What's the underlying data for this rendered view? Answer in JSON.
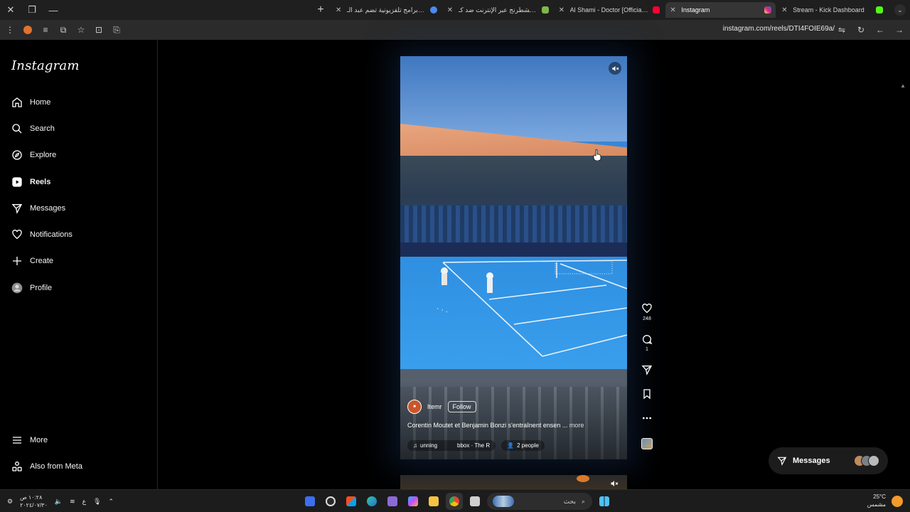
{
  "browser": {
    "tabs": [
      {
        "title": "أفلام وبرامج تلفزيونية تضم عبد الـ",
        "favicon_color": "#4a8af4"
      },
      {
        "title": "العب الشطرنج عبر الإنترنت ضد كـ",
        "favicon_color": "#81b64c"
      },
      {
        "title": "Al Shami - Doctor [Official Mus",
        "favicon_color": "#ff0033"
      },
      {
        "title": "Instagram",
        "favicon_color": "#d62976",
        "active": true
      },
      {
        "title": "Stream - Kick Dashboard",
        "favicon_color": "#53fc18"
      }
    ],
    "url": "instagram.com/reels/DTI4FOIE69a/"
  },
  "instagram": {
    "logo": "Instagram",
    "nav": [
      {
        "label": "Home",
        "icon": "home-icon"
      },
      {
        "label": "Search",
        "icon": "search-icon"
      },
      {
        "label": "Explore",
        "icon": "compass-icon"
      },
      {
        "label": "Reels",
        "icon": "reels-icon",
        "active": true
      },
      {
        "label": "Messages",
        "icon": "send-icon"
      },
      {
        "label": "Notifications",
        "icon": "heart-icon"
      },
      {
        "label": "Create",
        "icon": "plus-icon"
      },
      {
        "label": "Profile",
        "icon": "avatar-icon"
      }
    ],
    "nav_bottom": [
      {
        "label": "More",
        "icon": "menu-icon"
      },
      {
        "label": "Also from Meta",
        "icon": "meta-icon"
      }
    ],
    "reel": {
      "author": "Itemr",
      "follow_label": "Follow",
      "caption": "Corentin Moutet et Benjamin Bonzi s'entraînent ensen ...",
      "caption_more": "more",
      "audio": "unning",
      "audio_artist": "bbox · The R",
      "tagged": "2 people"
    },
    "actions": {
      "likes": "248",
      "comments": "1"
    },
    "messages_label": "Messages"
  },
  "taskbar": {
    "time": "١٠:٢٨ ص",
    "date": "٢٠٢٤/٠٧/٣٠",
    "lang": "ع",
    "search_placeholder": "بحث",
    "temperature": "25°C",
    "weather_text": "مشمس"
  }
}
